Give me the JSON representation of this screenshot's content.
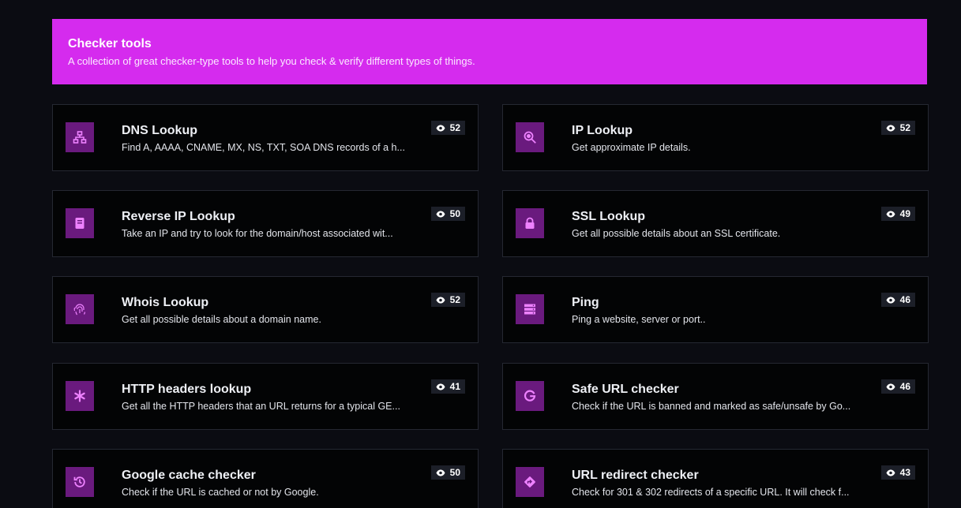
{
  "banner": {
    "title": "Checker tools",
    "description": "A collection of great checker-type tools to help you check & verify different types of things."
  },
  "colors": {
    "accent": "#d52bee",
    "icon_bg": "#6a1a7e",
    "icon_fg": "#ee82ff"
  },
  "tools": [
    {
      "title": "DNS Lookup",
      "description": "Find A, AAAA, CNAME, MX, NS, TXT, SOA DNS records of a h...",
      "views": "52",
      "icon": "sitemap-icon"
    },
    {
      "title": "IP Lookup",
      "description": "Get approximate IP details.",
      "views": "52",
      "icon": "search-location-icon"
    },
    {
      "title": "Reverse IP Lookup",
      "description": "Take an IP and try to look for the domain/host associated wit...",
      "views": "50",
      "icon": "book-icon"
    },
    {
      "title": "SSL Lookup",
      "description": "Get all possible details about an SSL certificate.",
      "views": "49",
      "icon": "lock-icon"
    },
    {
      "title": "Whois Lookup",
      "description": "Get all possible details about a domain name.",
      "views": "52",
      "icon": "fingerprint-icon"
    },
    {
      "title": "Ping",
      "description": "Ping a website, server or port..",
      "views": "46",
      "icon": "server-icon"
    },
    {
      "title": "HTTP headers lookup",
      "description": "Get all the HTTP headers that an URL returns for a typical GE...",
      "views": "41",
      "icon": "asterisk-icon"
    },
    {
      "title": "Safe URL checker",
      "description": "Check if the URL is banned and marked as safe/unsafe by Go...",
      "views": "46",
      "icon": "google-icon"
    },
    {
      "title": "Google cache checker",
      "description": "Check if the URL is cached or not by Google.",
      "views": "50",
      "icon": "history-icon"
    },
    {
      "title": "URL redirect checker",
      "description": "Check for 301 & 302 redirects of a specific URL. It will check f...",
      "views": "43",
      "icon": "directions-icon"
    }
  ]
}
